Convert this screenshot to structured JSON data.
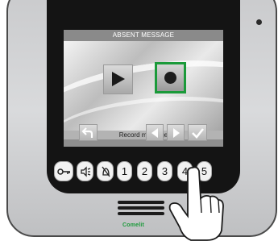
{
  "screen": {
    "title": "ABSENT MESSAGE",
    "record_label": "Record message"
  },
  "icons": {
    "play": "play-icon",
    "record": "record-icon",
    "back": "back-arrow-icon",
    "left": "left-arrow-icon",
    "right": "right-arrow-icon",
    "confirm": "checkmark-icon",
    "key": "key-icon",
    "speaker": "speaker-volume-icon",
    "bell_off": "bell-off-icon"
  },
  "keypad": {
    "keys": [
      "1",
      "2",
      "3",
      "4",
      "5"
    ]
  },
  "brand": {
    "name": "Comelit"
  },
  "colors": {
    "selection": "#1b9a3a",
    "brand": "#1b9a3a"
  }
}
